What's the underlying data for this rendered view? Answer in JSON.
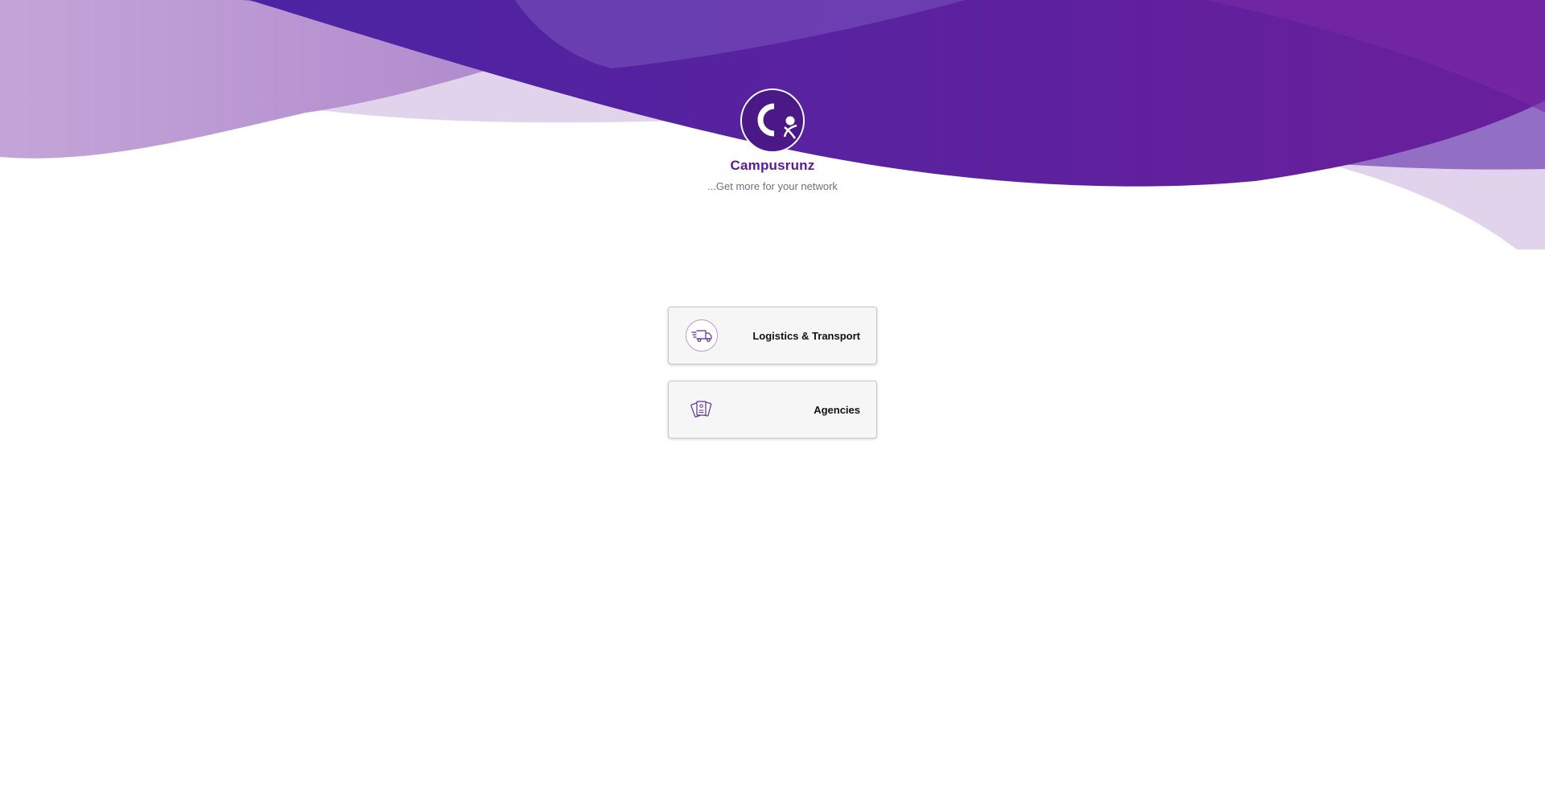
{
  "brand": {
    "name": "Campusrunz",
    "tagline": "...Get more for your network",
    "logo_letter": "C"
  },
  "options": [
    {
      "label": "Logistics & Transport",
      "icon": "delivery-truck-icon"
    },
    {
      "label": "Agencies",
      "icon": "id-cards-icon"
    }
  ],
  "colors": {
    "brand_purple": "#5b1a93",
    "logo_purple": "#4a1887",
    "wave_deep": "#5a2aa8",
    "wave_mid": "#8a63c0",
    "wave_light": "#c9a9dc",
    "wave_pale": "#e2d3ec"
  }
}
